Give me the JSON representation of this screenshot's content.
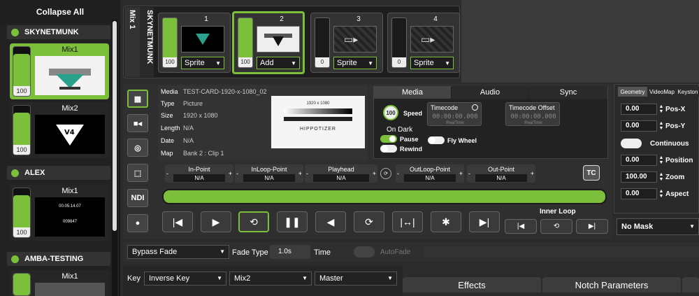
{
  "sidebar": {
    "collapse_label": "Collapse All",
    "groups": [
      {
        "name": "SKYNETMUNK",
        "mixes": [
          {
            "title": "Mix1",
            "fader": "100"
          },
          {
            "title": "Mix2",
            "fader": "100"
          }
        ]
      },
      {
        "name": "ALEX",
        "mixes": [
          {
            "title": "Mix1",
            "fader": "100",
            "thumb_line1": "00.05.14.07",
            "thumb_line2": "009847"
          }
        ]
      },
      {
        "name": "AMBA-TESTING",
        "mixes": [
          {
            "title": "Mix1",
            "fader": ""
          }
        ]
      }
    ]
  },
  "mix": {
    "label": "Mix 1",
    "server": "SKYNETMUNK",
    "layers": [
      {
        "num": "1",
        "fader": "100",
        "blend": "Sprite"
      },
      {
        "num": "2",
        "fader": "100",
        "blend": "Add"
      },
      {
        "num": "3",
        "fader": "0",
        "blend": "Sprite"
      },
      {
        "num": "4",
        "fader": "0",
        "blend": "Sprite"
      }
    ]
  },
  "side_icons": {
    "ndi": "NDI"
  },
  "media_info": {
    "media_key": "Media",
    "media": "TEST-CARD-1920-x-1080_02",
    "type_key": "Type",
    "type": "Picture",
    "size_key": "Size",
    "size": "1920 x 1080",
    "length_key": "Length",
    "length": "N/A",
    "date_key": "Date",
    "date": "N/A",
    "map_key": "Map",
    "map": "Bank 2 : Clip 1",
    "preview_res": "1920 x 1080",
    "preview_brand": "HIPPOTIZER"
  },
  "media_tabs": {
    "media": "Media",
    "audio": "Audio",
    "sync": "Sync"
  },
  "playback": {
    "speed_value": "100",
    "speed_label": "Speed",
    "on_dark": "On Dark",
    "pause": "Pause",
    "rewind": "Rewind",
    "fly_wheel": "Fly Wheel",
    "timecode_label": "Timecode",
    "timecode_value": "00:00:00.000",
    "timecode_offset_label": "Timecode Offset",
    "timecode_offset_value": "00:00:00.000",
    "realtime": "RealTime"
  },
  "points": [
    {
      "name": "In-Point",
      "value": "N/A"
    },
    {
      "name": "InLoop-Point",
      "value": "N/A"
    },
    {
      "name": "Playhead",
      "value": "N/A"
    },
    {
      "name": "OutLoop-Point",
      "value": "N/A"
    },
    {
      "name": "Out-Point",
      "value": "N/A"
    }
  ],
  "tc_button": "TC",
  "inner_loop": "Inner Loop",
  "fade": {
    "mode": "Bypass Fade",
    "type_label": "Fade Type",
    "time_value": "1.0s",
    "time_label": "Time",
    "autofade": "AutoFade"
  },
  "key": {
    "label": "Key",
    "mode": "Inverse Key",
    "source": "Mix2",
    "target": "Master"
  },
  "bottom_tabs": {
    "effects": "Effects",
    "notch": "Notch Parameters"
  },
  "right_panel": {
    "tabs": [
      "Geometry",
      "VideoMap",
      "Keyston"
    ],
    "rows": [
      {
        "value": "0.00",
        "label": "Pos-X"
      },
      {
        "value": "0.00",
        "label": "Pos-Y"
      },
      {
        "value": "",
        "label": "Continuous"
      },
      {
        "value": "0.00",
        "label": "Position"
      },
      {
        "value": "100.00",
        "label": "Zoom"
      },
      {
        "value": "0.00",
        "label": "Aspect"
      }
    ],
    "mask": "No Mask"
  },
  "colors": {
    "accent": "#7cbf3a",
    "bg": "#2b2b2b"
  }
}
